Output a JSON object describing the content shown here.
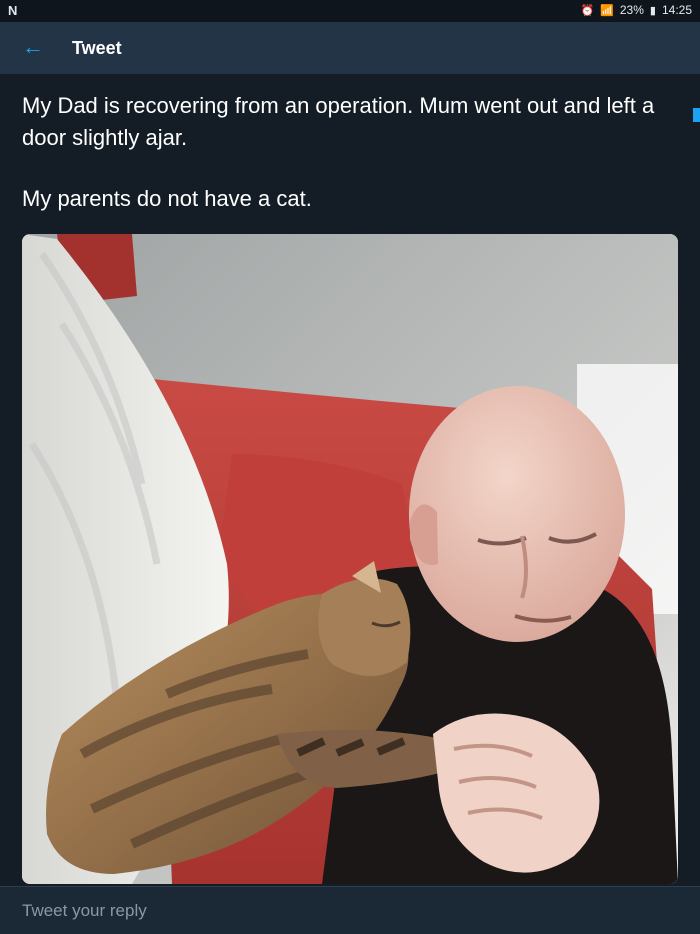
{
  "status_bar": {
    "left_label": "N",
    "battery": "23%",
    "time": "14:25",
    "icons": [
      "alarm-icon",
      "wifi-icon",
      "battery-icon"
    ]
  },
  "header": {
    "back_icon": "arrow-left-icon",
    "title": "Tweet"
  },
  "tweet": {
    "paragraphs": [
      "My Dad is recovering from an operation. Mum went out and left a door slightly ajar.",
      "My parents do not have a cat."
    ],
    "photo": {
      "subject": "cat-and-man-photo"
    }
  },
  "reply": {
    "placeholder": "Tweet your reply"
  },
  "colors": {
    "background": "#141d26",
    "app_bar": "#243447",
    "accent": "#1da1f2",
    "placeholder_text": "#8899a6"
  }
}
